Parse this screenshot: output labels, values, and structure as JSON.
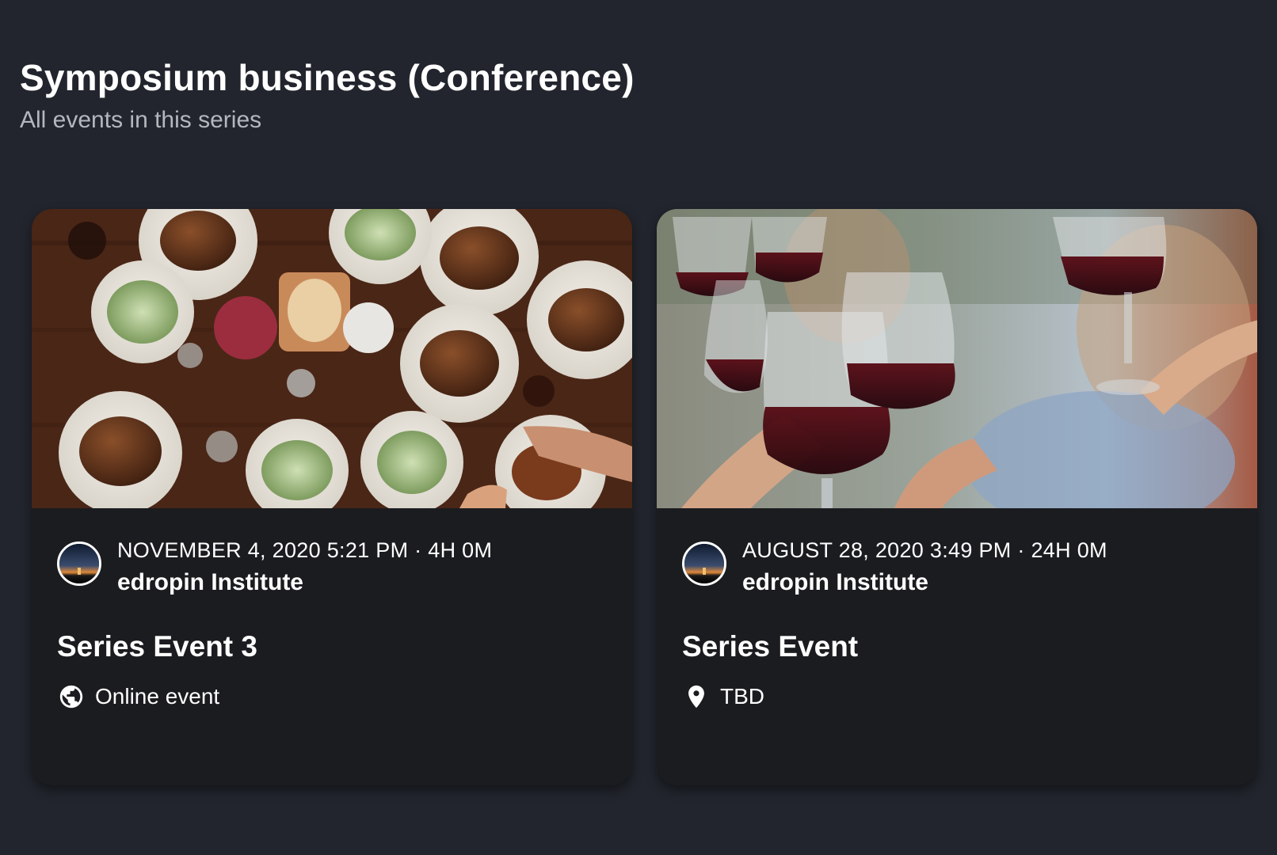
{
  "series": {
    "title": "Symposium business (Conference)",
    "subtitle": "All events in this series"
  },
  "events": [
    {
      "image": "dinner-table-photo",
      "datetime": "NOVEMBER 4, 2020 5:21 PM · 4H 0M",
      "organizer": "edropin Institute",
      "title": "Series Event 3",
      "location_icon": "globe-icon",
      "location": "Online event"
    },
    {
      "image": "wine-toast-photo",
      "datetime": "AUGUST 28, 2020 3:49 PM · 24H 0M",
      "organizer": "edropin Institute",
      "title": "Series Event",
      "location_icon": "map-pin-icon",
      "location": "TBD"
    }
  ],
  "colors": {
    "background": "#22252d",
    "card": "#1b1c1f",
    "subtitle": "#b4b7bd"
  }
}
